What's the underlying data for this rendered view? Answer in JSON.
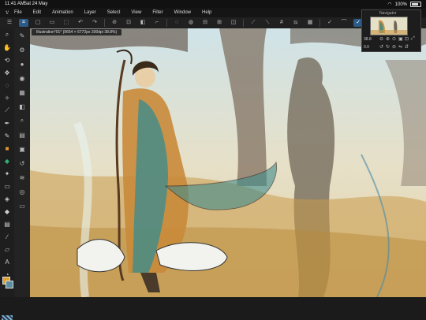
{
  "status": {
    "time": "11:41 AM",
    "date": "Sat 24 May",
    "battery": "100%"
  },
  "menu": [
    "File",
    "Edit",
    "Animation",
    "Layer",
    "Select",
    "View",
    "Filter",
    "Window",
    "Help"
  ],
  "document": {
    "tab_label": "Illustration*01* (9654 × 6772px 300dpi 38.8%)"
  },
  "navigator": {
    "title": "Navigator",
    "zoom": "38.8",
    "angle": "0.0"
  },
  "colors": {
    "foreground": "#e0a030",
    "background": "#5b8e9e",
    "accent": "#2d5b88"
  }
}
